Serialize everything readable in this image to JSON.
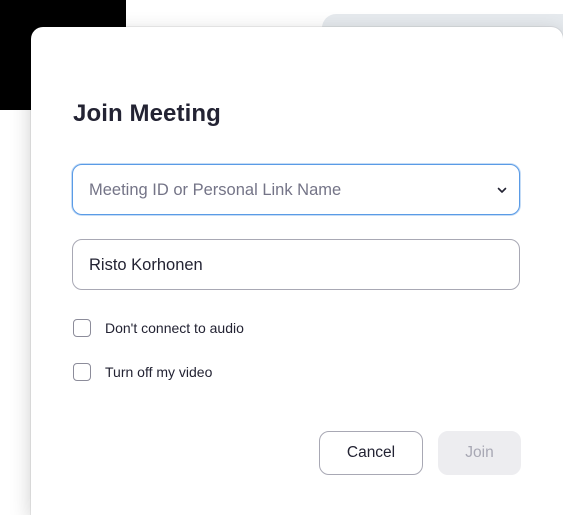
{
  "dialog": {
    "title": "Join Meeting",
    "meeting_id": {
      "placeholder": "Meeting ID or Personal Link Name",
      "value": ""
    },
    "name": {
      "value": "Risto Korhonen"
    },
    "options": [
      {
        "label": "Don't connect to audio",
        "checked": false
      },
      {
        "label": "Turn off my video",
        "checked": false
      }
    ],
    "buttons": {
      "cancel_label": "Cancel",
      "join_label": "Join"
    }
  },
  "colors": {
    "title_text": "#232333",
    "focus_border": "#5a9be6",
    "input_border": "#a8a8b4",
    "join_disabled_bg": "#ededf0",
    "join_disabled_text": "#a8a8b4"
  },
  "icons": {
    "dropdown": "chevron-down-icon"
  }
}
